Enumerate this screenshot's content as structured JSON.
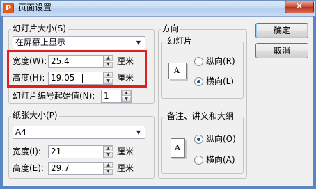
{
  "window": {
    "title": "页面设置",
    "app_icon": "presentation-app-icon",
    "close_glyph": "✕"
  },
  "slide_size": {
    "legend": "幻灯片大小(S)",
    "preset": "在屏幕上显示",
    "width_label": "宽度(W):",
    "width_value": "25.4",
    "height_label": "高度(H):",
    "height_value": "19.05",
    "unit": "厘米",
    "start_number_label": "幻灯片编号起始值(N):",
    "start_number_value": "1"
  },
  "paper_size": {
    "legend": "纸张大小(P)",
    "preset": "A4",
    "width_label": "宽度(I):",
    "width_value": "21",
    "height_label": "高度(E):",
    "height_value": "29.7",
    "unit": "厘米"
  },
  "orientation": {
    "legend": "方向",
    "slides": {
      "legend": "幻灯片",
      "portrait_label": "纵向(R)",
      "landscape_label": "横向(L)",
      "selected": "landscape"
    },
    "notes": {
      "legend": "备注、讲义和大纲",
      "portrait_label": "纵向(O)",
      "landscape_label": "横向(A)",
      "selected": "portrait"
    },
    "page_letter": "A"
  },
  "buttons": {
    "ok": "确定",
    "cancel": "取消"
  },
  "colors": {
    "highlight": "#e0201e",
    "title_bar": "#c5dcf5",
    "close_button": "#c7432b",
    "dialog_bg": "#f0f0f0"
  }
}
